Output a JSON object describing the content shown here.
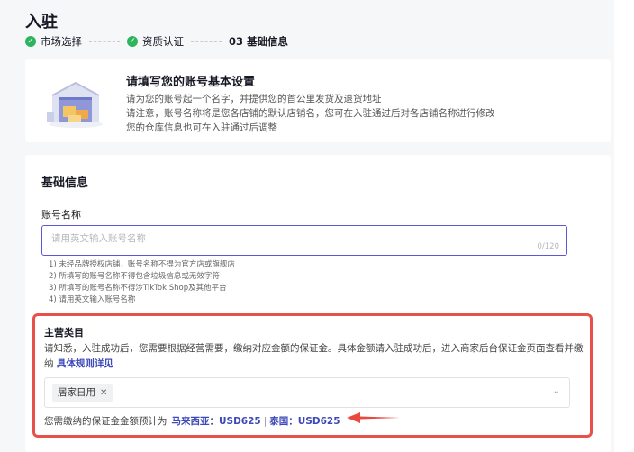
{
  "page": {
    "title": "入驻"
  },
  "steps": [
    {
      "label": "市场选择",
      "status": "done"
    },
    {
      "label": "资质认证",
      "status": "done"
    },
    {
      "number": "03",
      "label": "基础信息",
      "status": "current"
    }
  ],
  "intro": {
    "title": "请填写您的账号基本设置",
    "lines": [
      "请为您的账号起一个名字，并提供您的首公里发货及退货地址",
      "请注意，账号名称将是您各店铺的默认店铺名，您可在入驻通过后对各店铺名称进行修改",
      "您的仓库信息也可在入驻通过后调整"
    ]
  },
  "form": {
    "section_title": "基础信息",
    "account_label": "账号名称",
    "account_placeholder": "请用英文输入账号名称",
    "account_value": "",
    "account_counter": "0/120",
    "rules": [
      "1) 未经品牌授权店铺，账号名称不得为官方店或旗舰店",
      "2) 所填写的账号名称不得包含垃圾信息或无效字符",
      "3) 所填写的账号名称不得涉TikTok Shop及其他平台",
      "4) 请用英文输入账号名称"
    ]
  },
  "category": {
    "label": "主营类目",
    "notice": "请知悉，入驻成功后，您需要根据经营需要，缴纳对应金额的保证金。具体金额请入驻成功后，进入商家后台保证金页面查看并缴纳",
    "rule_link": "具体规则详见",
    "selected_tag": "居家日用",
    "deposit_prefix": "您需缴纳的保证金金额预计为",
    "deposit_malaysia": "马来西亚：USD625",
    "deposit_separator": "|",
    "deposit_thailand": "泰国：USD625"
  },
  "colors": {
    "accent": "#5b57d6",
    "success": "#2db55d",
    "highlight": "#e8504a",
    "link": "#3d49b8"
  },
  "icons": {
    "step_done": "check-circle-icon",
    "tag_remove": "close-icon",
    "select_toggle": "chevron-down-icon",
    "annotation": "red-arrow-icon"
  }
}
